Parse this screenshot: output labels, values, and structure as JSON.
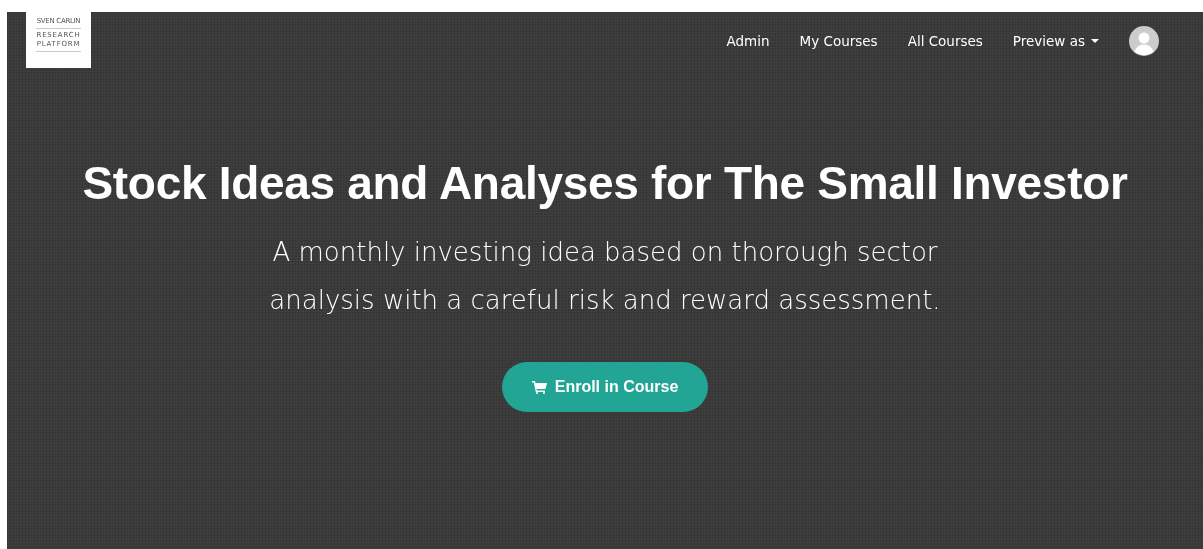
{
  "logo": {
    "top_line": "SVEN CARLIN",
    "lines": [
      "RESEARCH",
      "PLATFORM"
    ]
  },
  "nav": [
    {
      "label": "Admin",
      "kind": "link"
    },
    {
      "label": "My Courses",
      "kind": "link"
    },
    {
      "label": "All Courses",
      "kind": "link"
    },
    {
      "label": "Preview as",
      "kind": "dropdown"
    }
  ],
  "hero": {
    "title": "Stock Ideas and Analyses for The Small Investor",
    "subtitle": "A monthly investing idea based on thorough sector analysis with a careful risk and reward assessment.",
    "button": "Enroll in Course"
  }
}
